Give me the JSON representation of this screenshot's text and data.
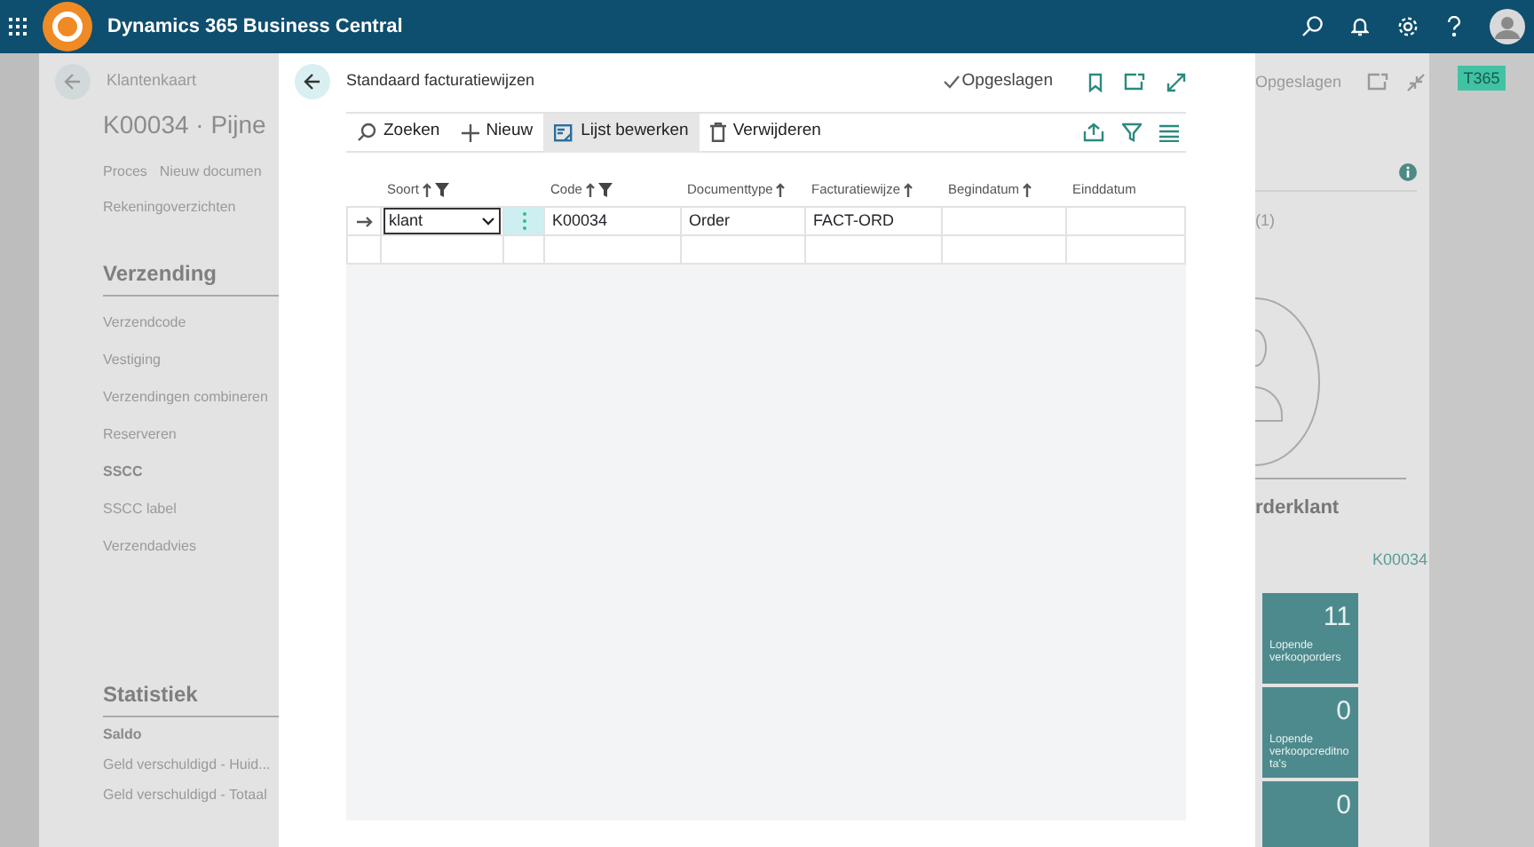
{
  "app_bar": {
    "title": "Dynamics 365 Business Central"
  },
  "background_page": {
    "breadcrumb": "Klantenkaart",
    "title": "K00034 · Pijne",
    "actions": [
      "Proces",
      "Nieuw documen"
    ],
    "actions_row_2": [
      "Rekeningoverzichten"
    ],
    "sections": [
      {
        "title": "Verzending",
        "fields": [
          {
            "kind": "field",
            "label": "Verzendcode"
          },
          {
            "kind": "field",
            "label": "Vestiging"
          },
          {
            "kind": "field",
            "label": "Verzendingen combineren"
          },
          {
            "kind": "field",
            "label": "Reserveren"
          },
          {
            "kind": "subheading",
            "label": "SSCC"
          },
          {
            "kind": "field",
            "label": "SSCC label"
          },
          {
            "kind": "field",
            "label": "Verzendadvies"
          }
        ]
      },
      {
        "title": "Statistiek",
        "fields": [
          {
            "kind": "subheading",
            "label": "Saldo"
          },
          {
            "kind": "field",
            "label": "Geld verschuldigd - Huid..."
          },
          {
            "kind": "field",
            "label": "Geld verschuldigd - Totaal"
          }
        ]
      }
    ],
    "status": "Opgeslagen",
    "badge": "T365",
    "factbox_count": "(1)",
    "factbox_title": "rderklant",
    "factbox_value": "K00034",
    "tiles": [
      {
        "value": "11",
        "label": "Lopende verkooporders"
      },
      {
        "value": "0",
        "label": "Lopende verkoopcreditnota's"
      },
      {
        "value": "0"
      }
    ]
  },
  "dialog": {
    "title": "Standaard facturatiewijzen",
    "status": "Opgeslagen",
    "toolbar": [
      {
        "kind": "search",
        "label": "Zoeken",
        "selected": false
      },
      {
        "kind": "new",
        "label": "Nieuw",
        "selected": false
      },
      {
        "kind": "edit-list",
        "label": "Lijst bewerken",
        "selected": true
      },
      {
        "kind": "delete",
        "label": "Verwijderen",
        "selected": false
      }
    ],
    "columns": [
      {
        "label": "Soort",
        "sorted": true,
        "filtered": true
      },
      {
        "label": "Code",
        "sorted": true,
        "filtered": true
      },
      {
        "label": "Documenttype",
        "sorted": true,
        "filtered": false
      },
      {
        "label": "Facturatiewijze",
        "sorted": true,
        "filtered": false
      },
      {
        "label": "Begindatum",
        "sorted": true,
        "filtered": false
      },
      {
        "label": "Einddatum",
        "sorted": false,
        "filtered": false
      }
    ],
    "rows": [
      {
        "selected": true,
        "cells": [
          "klant",
          "K00034",
          "Order",
          "FACT-ORD"
        ]
      }
    ]
  }
}
